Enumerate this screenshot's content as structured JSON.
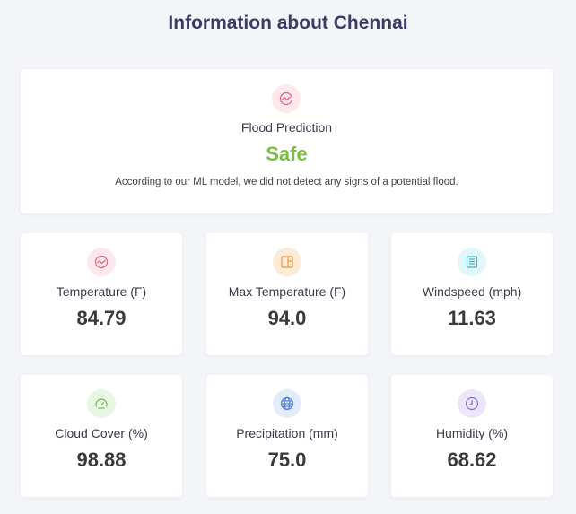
{
  "page": {
    "title": "Information about Chennai"
  },
  "flood": {
    "label": "Flood Prediction",
    "status": "Safe",
    "description": "According to our ML model, we did not detect any signs of a potential flood."
  },
  "stats": [
    {
      "label": "Temperature (F)",
      "value": "84.79",
      "icon": "wave-chart-icon",
      "color": "#e8607a",
      "bg": "#fde8ee"
    },
    {
      "label": "Max Temperature (F)",
      "value": "94.0",
      "icon": "panel-icon",
      "color": "#f0953a",
      "bg": "#fdebd9"
    },
    {
      "label": "Windspeed (mph)",
      "value": "11.63",
      "icon": "document-icon",
      "color": "#39b8c8",
      "bg": "#e2f7fa"
    },
    {
      "label": "Cloud Cover (%)",
      "value": "98.88",
      "icon": "gauge-icon",
      "color": "#6cbf52",
      "bg": "#e8f6e2"
    },
    {
      "label": "Precipitation (mm)",
      "value": "75.0",
      "icon": "globe-icon",
      "color": "#4a7fdc",
      "bg": "#e3ecfb"
    },
    {
      "label": "Humidity (%)",
      "value": "68.62",
      "icon": "clock-icon",
      "color": "#8b6fd6",
      "bg": "#ece6fb"
    }
  ],
  "colors": {
    "safe": "#7ac143",
    "title": "#3b3b63",
    "background": "#f4f5f9"
  }
}
